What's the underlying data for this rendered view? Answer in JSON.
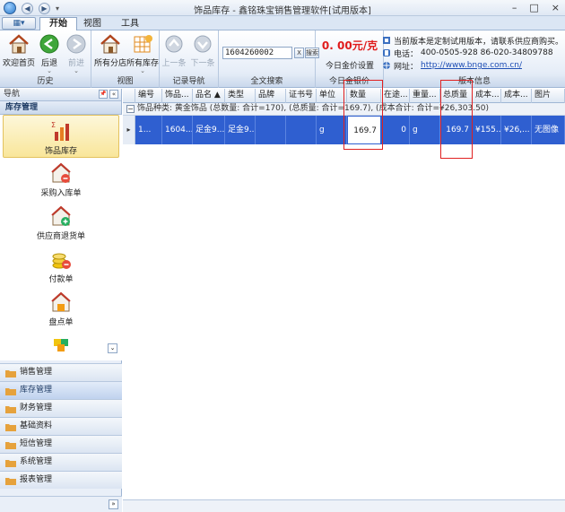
{
  "window": {
    "title": "饰品库存 - 鑫铭珠宝销售管理软件[试用版本]",
    "quick_access": [
      "◀",
      "▶",
      "▾"
    ],
    "controls": [
      "–",
      "□",
      "×"
    ]
  },
  "tabs": {
    "app_button": "▦▾",
    "items": [
      "开始",
      "视图",
      "工具"
    ]
  },
  "ribbon": {
    "history": {
      "title": "历史",
      "home": "欢迎首页",
      "back": "后退",
      "forward": "前进"
    },
    "view": {
      "title": "视图",
      "branches": "所有分店",
      "inventory": "所有库存"
    },
    "record_nav": {
      "title": "记录导航",
      "prev": "上一条",
      "next": "下一条"
    },
    "search": {
      "title": "全文搜索",
      "value": "1604260002",
      "btn_x": "X",
      "btn_go": "搜索"
    },
    "gold": {
      "title": "今日金银价",
      "price": "0. 00元/克",
      "setting": "今日金价设置"
    },
    "info": {
      "title": "版本信息",
      "notice": "当前版本是定制试用版本，请联系供应商购买。",
      "phone_label": "电话：",
      "phone": "400-0505-928  86-020-34809788",
      "web_label": "网址：",
      "url": "http://www.bnge.com.cn/"
    }
  },
  "nav": {
    "header": "导航",
    "pins": [
      "📌",
      "«"
    ],
    "section": "库存管理",
    "items": [
      "饰品库存",
      "采购入库单",
      "供应商退货单",
      "付款单",
      "盘点单",
      ""
    ],
    "expand_glyph": "⌄",
    "categories": [
      "销售管理",
      "库存管理",
      "财务管理",
      "基础资料",
      "短信管理",
      "系统管理",
      "报表管理"
    ],
    "footer_glyph": "»"
  },
  "grid": {
    "columns": [
      "编号",
      "饰品...",
      "品名 ▲",
      "类型",
      "品牌",
      "证书号",
      "单位",
      "数量",
      "在途...",
      "重量...",
      "总质量",
      "成本...",
      "成本...",
      "图片"
    ],
    "group_row": "饰品种类: 黄金饰品 (总数量: 合计=170), (总质量: 合计=169.7), (成本合计: 合计=¥26,303.50)",
    "rows": [
      [
        "1...",
        "1604...",
        "足金9...",
        "足金9...",
        "",
        "",
        "g",
        "169.7",
        "0",
        "g",
        "169.7",
        "¥155...",
        "¥26,...",
        "无图像"
      ]
    ],
    "row_indicator": "▸"
  },
  "colors": {
    "selection": "#2f5fd0",
    "highlight_box": "#e02020",
    "price_red": "#e01b1b"
  }
}
